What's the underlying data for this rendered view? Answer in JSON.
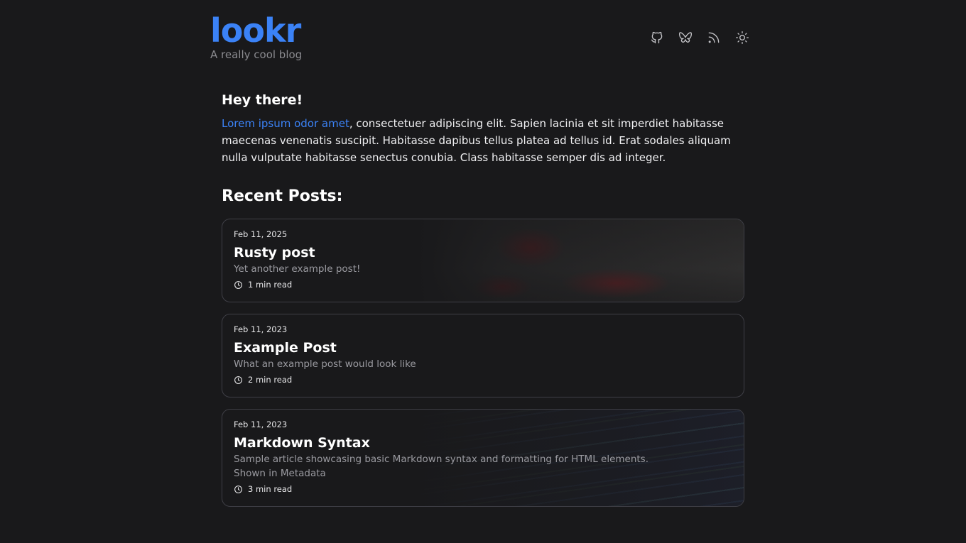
{
  "site": {
    "title": "lookr",
    "tagline": "A really cool blog",
    "accent": "#3b82f6"
  },
  "nav": {
    "icons": [
      "github-icon",
      "butterfly-icon",
      "rss-icon",
      "sun-icon"
    ]
  },
  "intro": {
    "heading": "Hey there!",
    "link_text": "Lorem ipsum odor amet",
    "body": ", consectetuer adipiscing elit. Sapien lacinia et sit imperdiet habitasse maecenas venenatis suscipit. Habitasse dapibus tellus platea ad tellus id. Erat sodales aliquam nulla vulputate habitasse senectus conubia. Class habitasse semper dis ad integer."
  },
  "recent": {
    "heading": "Recent Posts:",
    "posts": [
      {
        "date": "Feb 11, 2025",
        "title": "Rusty post",
        "description": "Yet another example post!",
        "read_time": "1 min read"
      },
      {
        "date": "Feb 11, 2023",
        "title": "Example Post",
        "description": "What an example post would look like",
        "read_time": "2 min read"
      },
      {
        "date": "Feb 11, 2023",
        "title": "Markdown Syntax",
        "description": "Sample article showcasing basic Markdown syntax and formatting for HTML elements.",
        "description_2": "Shown in Metadata",
        "read_time": "3 min read"
      }
    ]
  }
}
